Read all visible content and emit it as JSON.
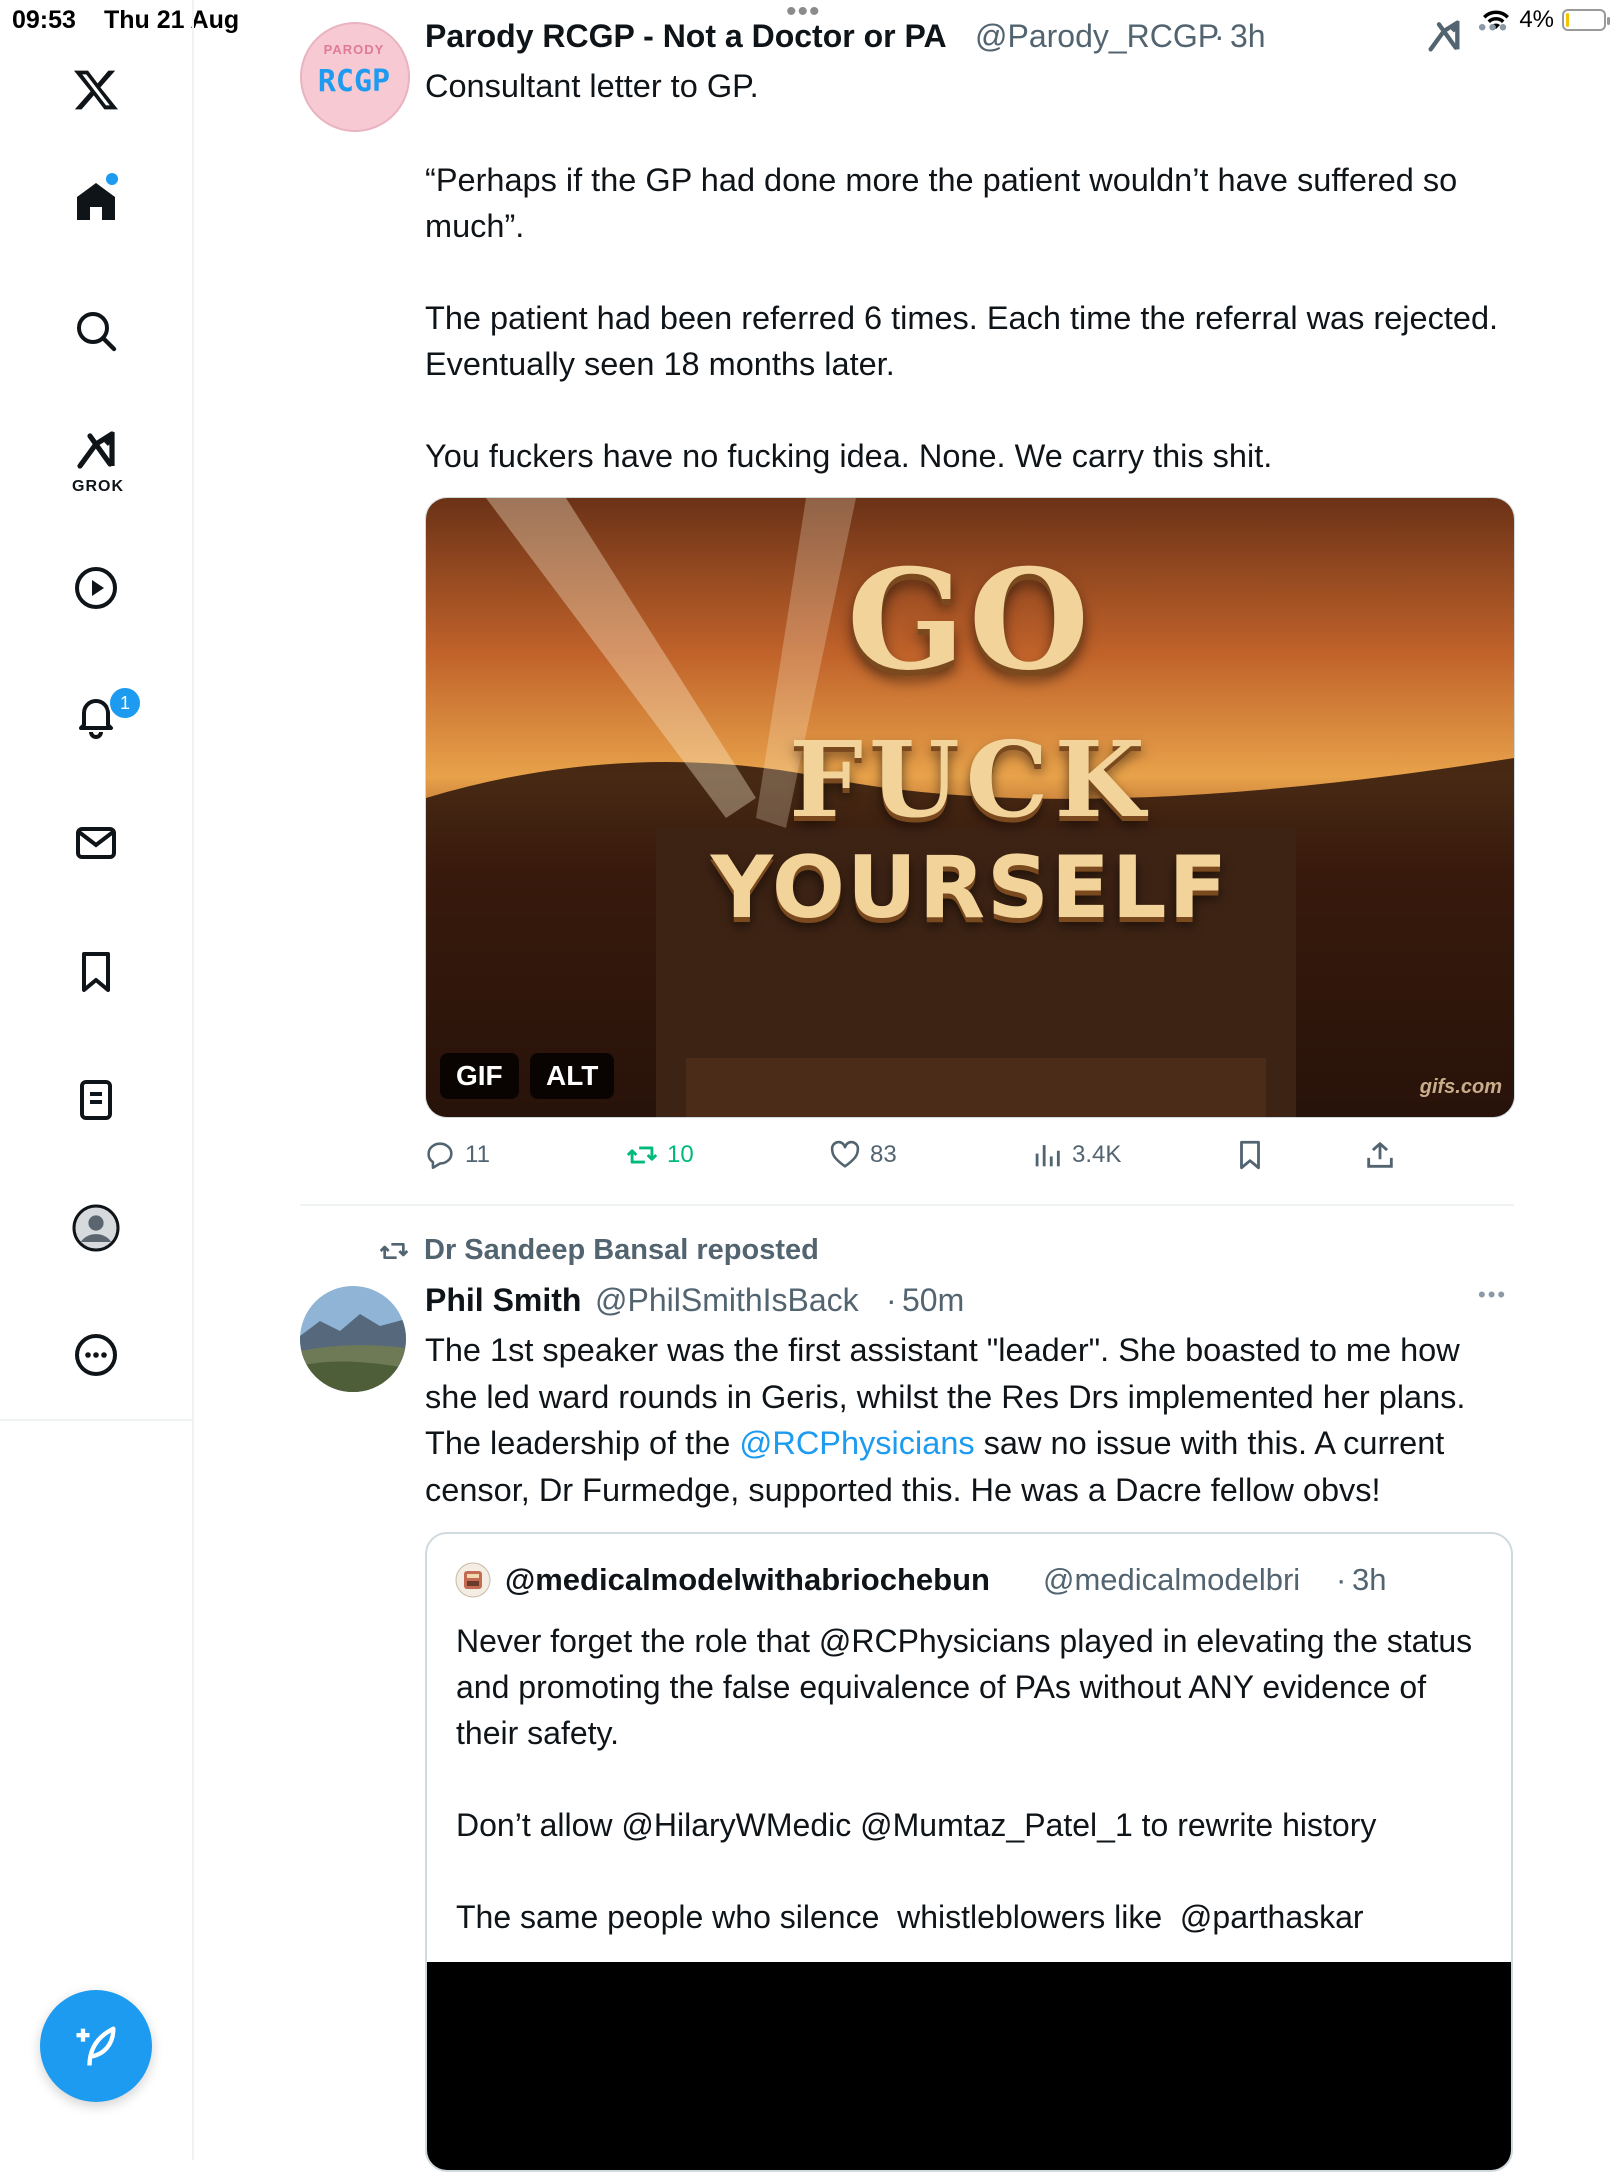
{
  "status_bar": {
    "time": "09:53",
    "date": "Thu 21 Aug",
    "battery": "4%"
  },
  "sidebar": {
    "items": [
      {
        "name": "x-logo",
        "label": "X"
      },
      {
        "name": "home",
        "label": "Home"
      },
      {
        "name": "explore",
        "label": "Explore"
      },
      {
        "name": "grok",
        "label": "GROK"
      },
      {
        "name": "video",
        "label": "Video"
      },
      {
        "name": "notifications",
        "label": "Notifications",
        "badge": "1"
      },
      {
        "name": "messages",
        "label": "Messages"
      },
      {
        "name": "bookmarks",
        "label": "Bookmarks"
      },
      {
        "name": "lists",
        "label": "Lists"
      },
      {
        "name": "profile",
        "label": "Profile"
      },
      {
        "name": "more",
        "label": "More"
      }
    ],
    "grok_label": "GROK",
    "notification_badge": "1",
    "accent_color": "#1d9bf0"
  },
  "tweet1": {
    "avatar_text_top": "PARODY",
    "avatar_text_main": "RCGP",
    "name": "Parody RCGP - Not a Doctor or PA",
    "handle": "@Parody_RCGP",
    "separator": "·",
    "time": "3h",
    "text_p1": "Consultant letter to GP.",
    "text_p2": "“Perhaps if the GP had done more the patient wouldn’t have suffered so much”.",
    "text_p3": "The patient had been referred 6 times. Each time the referral was rejected. Eventually seen 18 months later.",
    "text_p4": "You fuckers have no fucking idea. None. We carry this shit.",
    "media": {
      "line1": "GO",
      "line2": "FUCK",
      "line3": "YOURSELF",
      "watermark": "gifs.com",
      "gif_label": "GIF",
      "alt_label": "ALT"
    },
    "actions": {
      "replies": "11",
      "reposts": "10",
      "likes": "83",
      "views": "3.4K"
    },
    "repost_color": "#00ba7c"
  },
  "tweet2": {
    "reposted_by": "Dr Sandeep Bansal reposted",
    "name": "Phil Smith",
    "handle": "@PhilSmithIsBack",
    "separator": "·",
    "time": "50m",
    "text_a": "The 1st speaker was the first assistant \"leader\". She boasted to me how she led ward rounds in Geris, whilst the Res Drs implemented her plans. The leadership of the ",
    "text_link": "@RCPhysicians",
    "text_b": " saw no issue with this. A current censor, Dr Furmedge, supported this. He was a Dacre fellow obvs!",
    "quote": {
      "name": "@medicalmodelwithabriochebun",
      "handle": "@medicalmodelbri",
      "separator": "·",
      "time": "3h",
      "text_p1": "Never forget the role that @RCPhysicians played in elevating the status and promoting the false equivalence of PAs without ANY evidence of their safety.",
      "text_p2": "Don’t allow @HilaryWMedic @Mumtaz_Patel_1 to rewrite history",
      "text_p3": "The same people who silence  whistleblowers like  @parthaskar"
    }
  }
}
